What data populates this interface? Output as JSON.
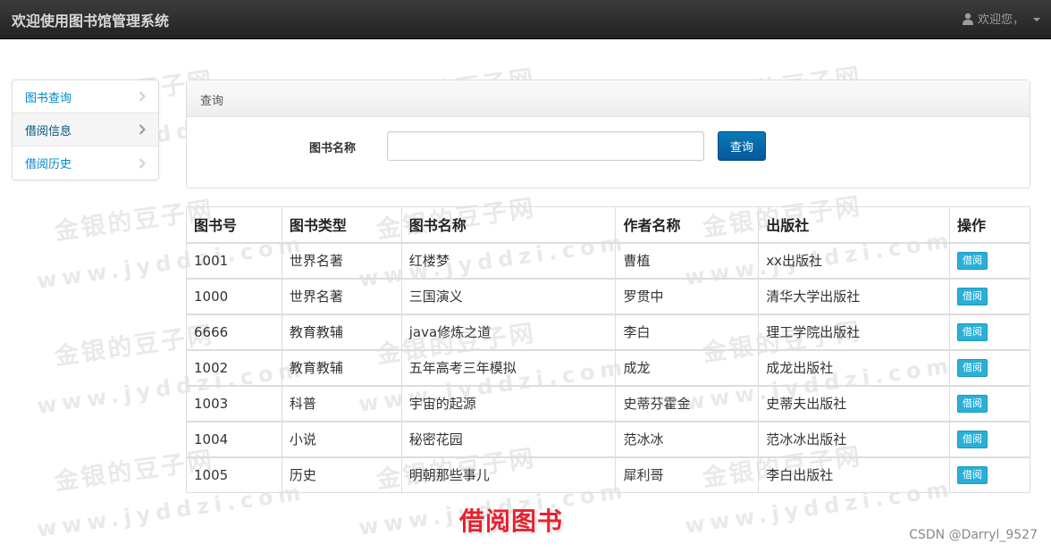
{
  "navbar": {
    "brand": "欢迎使用图书馆管理系统",
    "user_greeting": "欢迎您，"
  },
  "sidebar": {
    "items": [
      {
        "label": "图书查询"
      },
      {
        "label": "借阅信息"
      },
      {
        "label": "借阅历史"
      }
    ]
  },
  "query_panel": {
    "heading": "查询",
    "field_label": "图书名称",
    "input_value": "",
    "button_label": "查询"
  },
  "table": {
    "headers": [
      "图书号",
      "图书类型",
      "图书名称",
      "作者名称",
      "出版社",
      "操作"
    ],
    "action_label": "借阅",
    "rows": [
      [
        "1001",
        "世界名著",
        "红楼梦",
        "曹植",
        "xx出版社"
      ],
      [
        "1000",
        "世界名著",
        "三国演义",
        "罗贯中",
        "清华大学出版社"
      ],
      [
        "6666",
        "教育教辅",
        "java修炼之道",
        "李白",
        "理工学院出版社"
      ],
      [
        "1002",
        "教育教辅",
        "五年高考三年模拟",
        "成龙",
        "成龙出版社"
      ],
      [
        "1003",
        "科普",
        "宇宙的起源",
        "史蒂芬霍金",
        "史蒂夫出版社"
      ],
      [
        "1004",
        "小说",
        "秘密花园",
        "范冰冰",
        "范冰冰出版社"
      ],
      [
        "1005",
        "历史",
        "明朝那些事儿",
        "犀利哥",
        "李白出版社"
      ]
    ]
  },
  "caption": "借阅图书",
  "credit": "CSDN @Darryl_9527",
  "watermark": {
    "line1": "金银的豆子网",
    "line2": "www.jyddzi.com"
  },
  "colors": {
    "navbar_bg": "#2a2a2a",
    "link": "#0088cc",
    "primary_button": "#05589a",
    "info_button": "#2ab0d8",
    "caption": "#e8212e"
  },
  "icons": [
    "user-icon",
    "caret-down-icon",
    "chevron-right-icon"
  ]
}
